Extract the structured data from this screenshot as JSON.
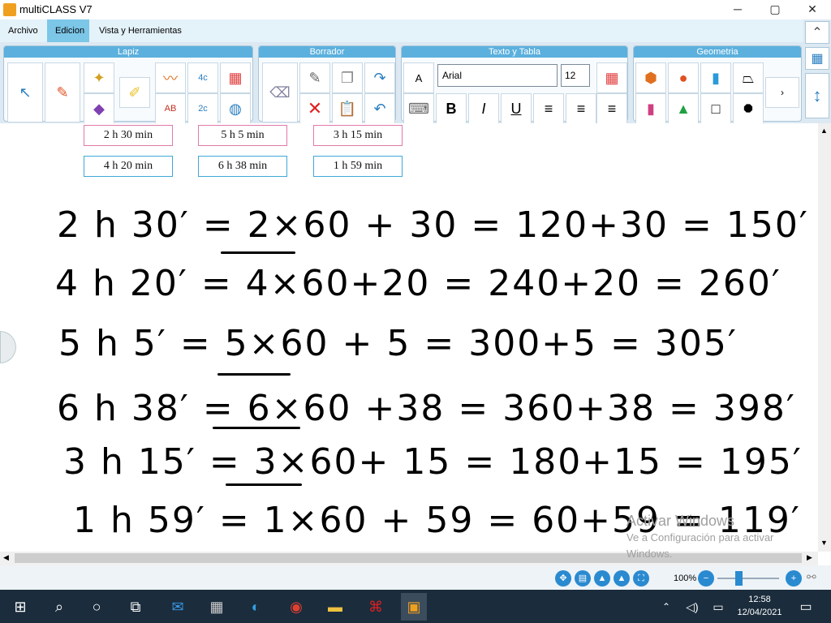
{
  "window": {
    "title": "multiCLASS V7",
    "minimize": "─",
    "maximize": "▢",
    "close": "✕"
  },
  "menu": {
    "archivo": "Archivo",
    "edicion": "Edicion",
    "vista": "Vista y Herramientas"
  },
  "ribbon": {
    "groups": {
      "lapiz": "Lapiz",
      "borrador": "Borrador",
      "texto": "Texto y Tabla",
      "geometria": "Geometria"
    },
    "font": "Arial",
    "font_size": "12",
    "bold": "B",
    "italic": "I",
    "underline": "U"
  },
  "time_boxes": {
    "row1": [
      "2 h 30 min",
      "5 h 5 min",
      "3 h 15 min"
    ],
    "row2": [
      "4 h 20 min",
      "6 h 38 min",
      "1 h 59 min"
    ]
  },
  "handwriting": [
    "2 h 30′ = 2×60 + 30 = 120+30 = 150′",
    "4 h 20′ = 4×60+20 = 240+20 = 260′",
    "5 h 5′ = 5×60 + 5 = 300+5 = 305′",
    "6 h 38′ = 6×60 +38 = 360+38 = 398′",
    "3 h 15′ = 3×60+ 15 = 180+15 = 195′",
    "1 h 59′ = 1×60 + 59 = 60+59 = 119′"
  ],
  "status": {
    "zoom": "100%"
  },
  "watermark": {
    "title": "Activar Windows",
    "subtitle": "Ve a Configuración para activar Windows."
  },
  "taskbar": {
    "time": "12:58",
    "date": "12/04/2021"
  },
  "colors": {
    "ribbon_header": "#5bb0dd",
    "menu_active": "#7cc6e8",
    "pink_border": "#e07aa8",
    "cyan_border": "#3fa8d8",
    "taskbar": "#1b2c3c"
  }
}
